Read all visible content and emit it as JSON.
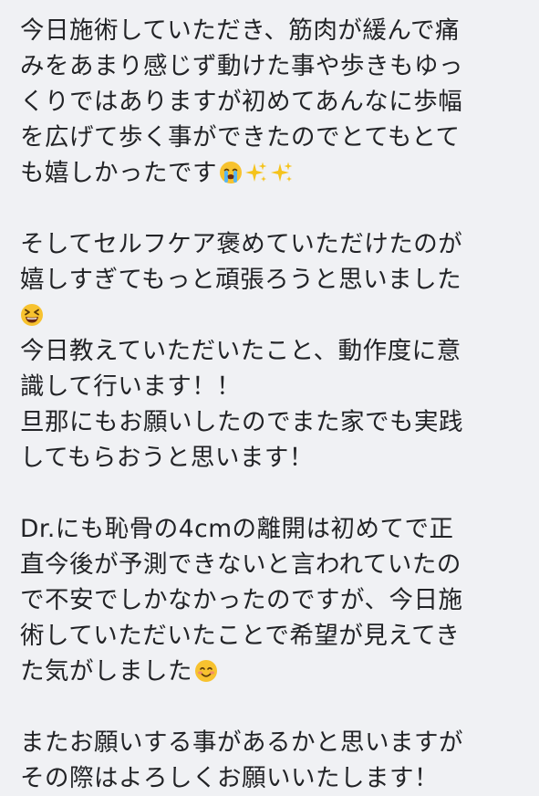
{
  "message": {
    "lines": {
      "p1": [
        "今日施術していただき、筋肉が緩んで痛",
        "みをあまり感じず動けた事や歩きもゆっ",
        "くりではありますが初めてあんなに歩幅",
        "を広げて歩く事ができたのでとてもとて",
        "も嬉しかったです"
      ],
      "p2": [
        "そしてセルフケア褒めていただけたのが",
        "嬉しすぎてもっと頑張ろうと思いました",
        "今日教えていただいたこと、動作度に意",
        "識して行います！！",
        "旦那にもお願いしたのでまた家でも実践",
        "してもらおうと思います！"
      ],
      "p3": [
        "Dr.にも恥骨の4cmの離開は初めてで正",
        "直今後が予測できないと言われていたの",
        "で不安でしかなかったのですが、今日施",
        "術していただいたことで希望が見えてき",
        "た気がしました"
      ],
      "p4": [
        "またお願いする事があるかと思いますが",
        "その際はよろしくお願いいたします！"
      ]
    },
    "emojis": {
      "crying": "loudly-crying-face-emoji",
      "sparkles": "sparkles-emoji",
      "grin": "grinning-squinting-face-emoji",
      "smile": "smiling-face-emoji"
    }
  }
}
